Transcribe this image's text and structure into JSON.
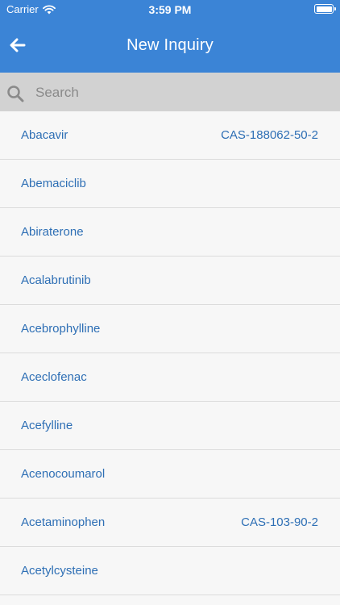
{
  "status_bar": {
    "carrier": "Carrier",
    "time": "3:59 PM",
    "battery_level": 1.0
  },
  "nav": {
    "title": "New Inquiry",
    "back_icon": "arrow-left-icon"
  },
  "search": {
    "placeholder": "Search",
    "value": ""
  },
  "colors": {
    "header": "#3b84d6",
    "search_bar": "#d2d2d2",
    "list_background": "#f7f7f7",
    "item_text": "#2e6fb5",
    "divider": "#dcdcdc"
  },
  "items": [
    {
      "name": "Abacavir",
      "cas": "CAS-188062-50-2"
    },
    {
      "name": "Abemaciclib",
      "cas": ""
    },
    {
      "name": "Abiraterone",
      "cas": ""
    },
    {
      "name": "Acalabrutinib",
      "cas": ""
    },
    {
      "name": "Acebrophylline",
      "cas": ""
    },
    {
      "name": "Aceclofenac",
      "cas": ""
    },
    {
      "name": "Acefylline",
      "cas": ""
    },
    {
      "name": "Acenocoumarol",
      "cas": ""
    },
    {
      "name": "Acetaminophen",
      "cas": "CAS-103-90-2"
    },
    {
      "name": "Acetylcysteine",
      "cas": ""
    }
  ]
}
